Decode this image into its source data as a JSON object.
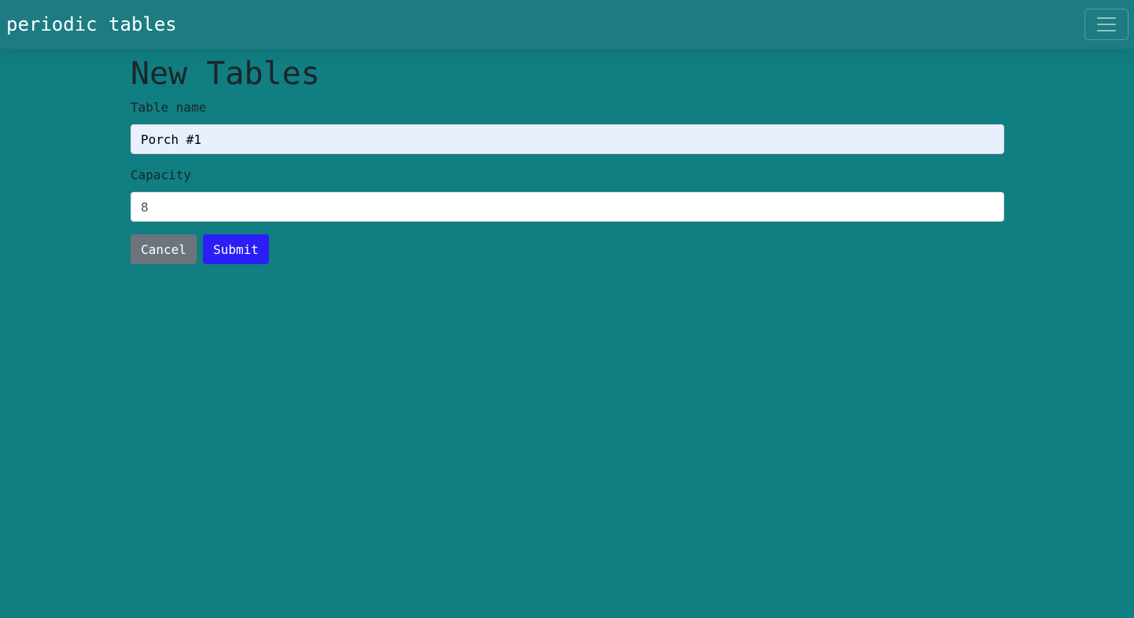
{
  "navbar": {
    "brand": "periodic tables",
    "toggler_icon": "hamburger-menu-icon"
  },
  "page": {
    "title": "New Tables"
  },
  "form": {
    "table_name": {
      "label": "Table name",
      "value": "Porch #1"
    },
    "capacity": {
      "label": "Capacity",
      "value": "8"
    },
    "cancel_label": "Cancel",
    "submit_label": "Submit"
  },
  "colors": {
    "background": "#117e82",
    "navbar": "#1c7c82",
    "cancel_button": "#6c757d",
    "submit_button": "#2a1ff6",
    "autofill_input": "#e8f0fe"
  }
}
